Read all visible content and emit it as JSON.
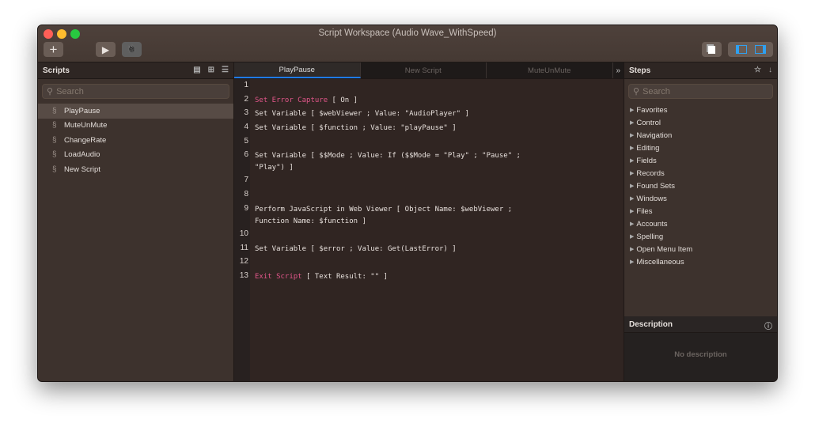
{
  "window": {
    "title": "Script Workspace (Audio Wave_WithSpeed)"
  },
  "toolbar": {
    "add": "+",
    "run": "▶",
    "debug": "🐞"
  },
  "scripts": {
    "header": "Scripts",
    "search_placeholder": "Search",
    "items": [
      "PlayPause",
      "MuteUnMute",
      "ChangeRate",
      "LoadAudio",
      "New Script"
    ],
    "selected": "PlayPause"
  },
  "tabs": [
    {
      "label": "PlayPause",
      "active": true
    },
    {
      "label": "New Script"
    },
    {
      "label": "MuteUnMute"
    }
  ],
  "tabs_more": "»",
  "code": [
    {
      "n": "1",
      "seg": []
    },
    {
      "n": "2",
      "seg": [
        {
          "k": true,
          "t": "Set Error Capture"
        },
        {
          "t": " [ On ]"
        }
      ]
    },
    {
      "n": "3",
      "seg": [
        {
          "t": "Set Variable [ $webViewer ; Value: \"AudioPlayer\" ]"
        }
      ]
    },
    {
      "n": "4",
      "seg": [
        {
          "t": "Set Variable [ $function ; Value: \"playPause\" ]"
        }
      ]
    },
    {
      "n": "5",
      "seg": []
    },
    {
      "n": "6",
      "seg": [
        {
          "t": "Set Variable [ $$Mode ; Value: If ($$Mode = \"Play\" ; \"Pause\" ; \"Play\") ]"
        }
      ]
    },
    {
      "n": "7",
      "seg": []
    },
    {
      "n": "8",
      "seg": []
    },
    {
      "n": "9",
      "seg": [
        {
          "t": "Perform JavaScript in Web Viewer [ Object Name: $webViewer ; Function Name: $function ]"
        }
      ]
    },
    {
      "n": "10",
      "seg": []
    },
    {
      "n": "11",
      "seg": [
        {
          "t": "Set Variable [ $error ; Value: Get(LastError) ]"
        }
      ]
    },
    {
      "n": "12",
      "seg": []
    },
    {
      "n": "13",
      "seg": [
        {
          "k": true,
          "t": "Exit Script"
        },
        {
          "t": " [ Text Result: \"\" ]"
        }
      ]
    }
  ],
  "steps": {
    "header": "Steps",
    "search_placeholder": "Search",
    "items": [
      "Favorites",
      "Control",
      "Navigation",
      "Editing",
      "Fields",
      "Records",
      "Found Sets",
      "Windows",
      "Files",
      "Accounts",
      "Spelling",
      "Open Menu Item",
      "Miscellaneous"
    ]
  },
  "description": {
    "header": "Description",
    "empty": "No description"
  }
}
